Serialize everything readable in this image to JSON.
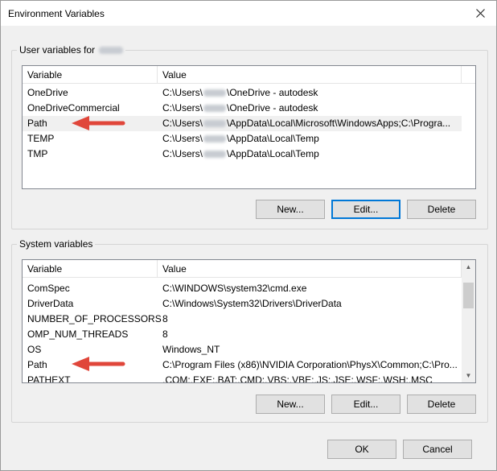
{
  "window": {
    "title": "Environment Variables"
  },
  "user_vars": {
    "legend": "User variables for",
    "columns": {
      "variable": "Variable",
      "value": "Value"
    },
    "rows": [
      {
        "variable": "OneDrive",
        "value_prefix": "C:\\Users\\",
        "value_suffix": "\\OneDrive - autodesk"
      },
      {
        "variable": "OneDriveCommercial",
        "value_prefix": "C:\\Users\\",
        "value_suffix": "\\OneDrive - autodesk"
      },
      {
        "variable": "Path",
        "value_prefix": "C:\\Users\\",
        "value_suffix": "\\AppData\\Local\\Microsoft\\WindowsApps;C:\\Progra..."
      },
      {
        "variable": "TEMP",
        "value_prefix": "C:\\Users\\",
        "value_suffix": "\\AppData\\Local\\Temp"
      },
      {
        "variable": "TMP",
        "value_prefix": "C:\\Users\\",
        "value_suffix": "\\AppData\\Local\\Temp"
      }
    ],
    "buttons": {
      "new": "New...",
      "edit": "Edit...",
      "delete": "Delete"
    }
  },
  "system_vars": {
    "legend": "System variables",
    "columns": {
      "variable": "Variable",
      "value": "Value"
    },
    "rows": [
      {
        "variable": "ComSpec",
        "value": "C:\\WINDOWS\\system32\\cmd.exe"
      },
      {
        "variable": "DriverData",
        "value": "C:\\Windows\\System32\\Drivers\\DriverData"
      },
      {
        "variable": "NUMBER_OF_PROCESSORS",
        "value": "8"
      },
      {
        "variable": "OMP_NUM_THREADS",
        "value": "8"
      },
      {
        "variable": "OS",
        "value": "Windows_NT"
      },
      {
        "variable": "Path",
        "value": "C:\\Program Files (x86)\\NVIDIA Corporation\\PhysX\\Common;C:\\Pro..."
      },
      {
        "variable": "PATHEXT",
        "value": ".COM;.EXE;.BAT;.CMD;.VBS;.VBE;.JS;.JSE;.WSF;.WSH;.MSC"
      }
    ],
    "buttons": {
      "new": "New...",
      "edit": "Edit...",
      "delete": "Delete"
    }
  },
  "footer": {
    "ok": "OK",
    "cancel": "Cancel"
  },
  "colors": {
    "annotation_arrow": "#e0463a",
    "focus_border": "#0078d7"
  },
  "icons": {
    "close": "close-icon",
    "scroll_up": "scroll-up-icon",
    "scroll_down": "scroll-down-icon"
  }
}
